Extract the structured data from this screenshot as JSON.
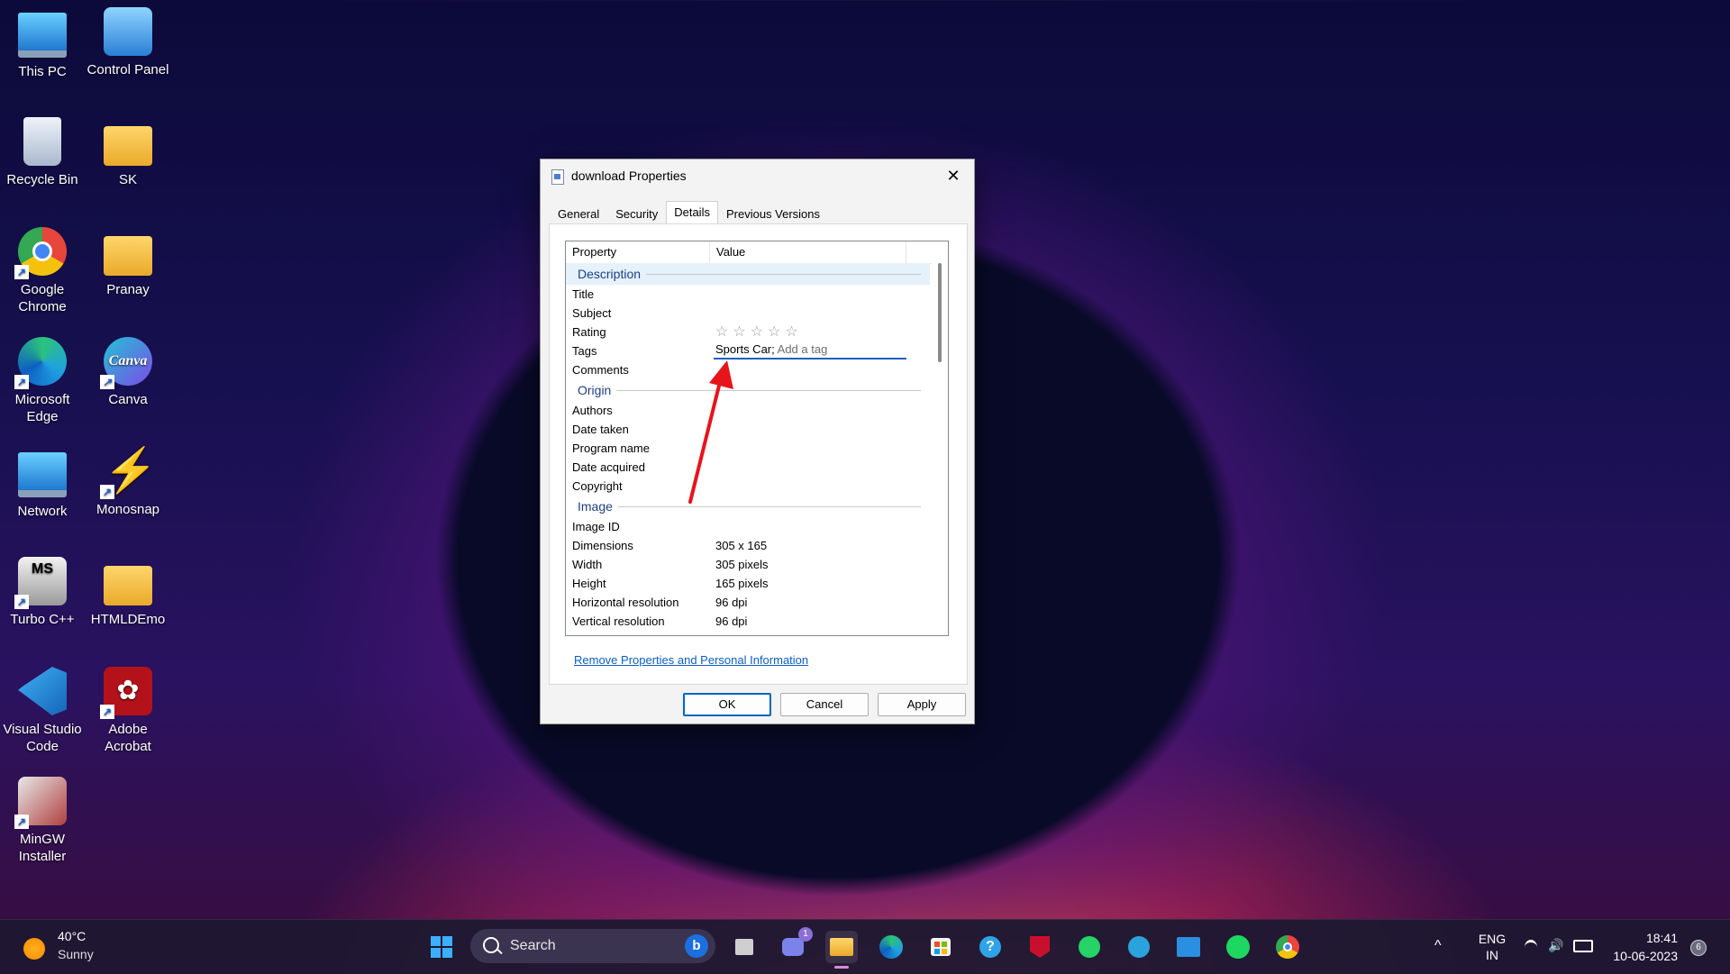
{
  "desktop": {
    "icons": [
      {
        "label": "This PC",
        "icon": "monitor-icon",
        "color": "#3aa0e8"
      },
      {
        "label": "Control Panel",
        "icon": "control-panel-icon",
        "color": "#4aa6ee"
      },
      {
        "label": "Recycle Bin",
        "icon": "recycle-bin-icon",
        "color": "#cfd8e6"
      },
      {
        "label": "SK",
        "icon": "folder-icon",
        "color": "#f4c04a"
      },
      {
        "label": "Google Chrome",
        "icon": "chrome-icon",
        "color": "#e8453c"
      },
      {
        "label": "Pranay",
        "icon": "user-folder-icon",
        "color": "#f4c04a"
      },
      {
        "label": "Microsoft Edge",
        "icon": "edge-icon",
        "color": "#1fa0e0"
      },
      {
        "label": "Canva",
        "icon": "canva-icon",
        "color": "#7d4ae6"
      },
      {
        "label": "Network",
        "icon": "network-icon",
        "color": "#3aa0e8"
      },
      {
        "label": "Monosnap",
        "icon": "monosnap-icon",
        "color": "#f5b21a"
      },
      {
        "label": "Turbo C++",
        "icon": "turbo-cpp-icon",
        "color": "#d8d8d8"
      },
      {
        "label": "HTMLDEmo",
        "icon": "folder-icon",
        "color": "#f4c04a"
      },
      {
        "label": "Visual Studio Code",
        "icon": "vscode-icon",
        "color": "#1f8ad2"
      },
      {
        "label": "Adobe Acrobat",
        "icon": "acrobat-icon",
        "color": "#b3121a"
      },
      {
        "label": "MinGW Installer",
        "icon": "installer-icon",
        "color": "#c04040"
      }
    ]
  },
  "dialog": {
    "title": "download Properties",
    "close_glyph": "✕",
    "tabs": [
      "General",
      "Security",
      "Details",
      "Previous Versions"
    ],
    "active_tab": "Details",
    "columns": {
      "property": "Property",
      "value": "Value"
    },
    "groups": {
      "description": "Description",
      "origin": "Origin",
      "image": "Image"
    },
    "rows": {
      "title": {
        "k": "Title",
        "v": ""
      },
      "subject": {
        "k": "Subject",
        "v": ""
      },
      "rating": {
        "k": "Rating",
        "stars": "☆☆☆☆☆",
        "value": 0
      },
      "tags": {
        "k": "Tags",
        "v": "Sports Car;",
        "placeholder": "Add a tag"
      },
      "comments": {
        "k": "Comments",
        "v": ""
      },
      "authors": {
        "k": "Authors",
        "v": ""
      },
      "date_taken": {
        "k": "Date taken",
        "v": ""
      },
      "program_name": {
        "k": "Program name",
        "v": ""
      },
      "date_acquired": {
        "k": "Date acquired",
        "v": ""
      },
      "copyright": {
        "k": "Copyright",
        "v": ""
      },
      "image_id": {
        "k": "Image ID",
        "v": ""
      },
      "dimensions": {
        "k": "Dimensions",
        "v": "305 x 165"
      },
      "width": {
        "k": "Width",
        "v": "305 pixels"
      },
      "height": {
        "k": "Height",
        "v": "165 pixels"
      },
      "h_res": {
        "k": "Horizontal resolution",
        "v": "96 dpi"
      },
      "v_res": {
        "k": "Vertical resolution",
        "v": "96 dpi"
      }
    },
    "remove_link": "Remove Properties and Personal Information",
    "buttons": {
      "ok": "OK",
      "cancel": "Cancel",
      "apply": "Apply"
    }
  },
  "annotation": {
    "arrow_color": "#e8141c"
  },
  "taskbar": {
    "weather": {
      "temp": "40°C",
      "condition": "Sunny"
    },
    "search": {
      "placeholder": "Search",
      "bing": "b"
    },
    "apps": [
      {
        "name": "start",
        "icon": "windows-icon"
      },
      {
        "name": "task-view",
        "icon": "task-view-icon"
      },
      {
        "name": "teams",
        "icon": "teams-icon",
        "badge": "1"
      },
      {
        "name": "file-explorer",
        "icon": "folder-icon"
      },
      {
        "name": "edge",
        "icon": "edge-icon"
      },
      {
        "name": "store",
        "icon": "store-icon"
      },
      {
        "name": "help",
        "icon": "help-icon"
      },
      {
        "name": "mcafee",
        "icon": "mcafee-icon"
      },
      {
        "name": "whatsapp",
        "icon": "whatsapp-icon"
      },
      {
        "name": "telegram",
        "icon": "telegram-icon"
      },
      {
        "name": "myhp",
        "icon": "myhp-icon"
      },
      {
        "name": "spotify",
        "icon": "spotify-icon"
      },
      {
        "name": "chrome",
        "icon": "chrome-icon"
      }
    ],
    "tray": {
      "chevron": "^",
      "lang": "ENG",
      "region": "IN",
      "time": "18:41",
      "date": "10-06-2023",
      "notifications": "6"
    }
  }
}
